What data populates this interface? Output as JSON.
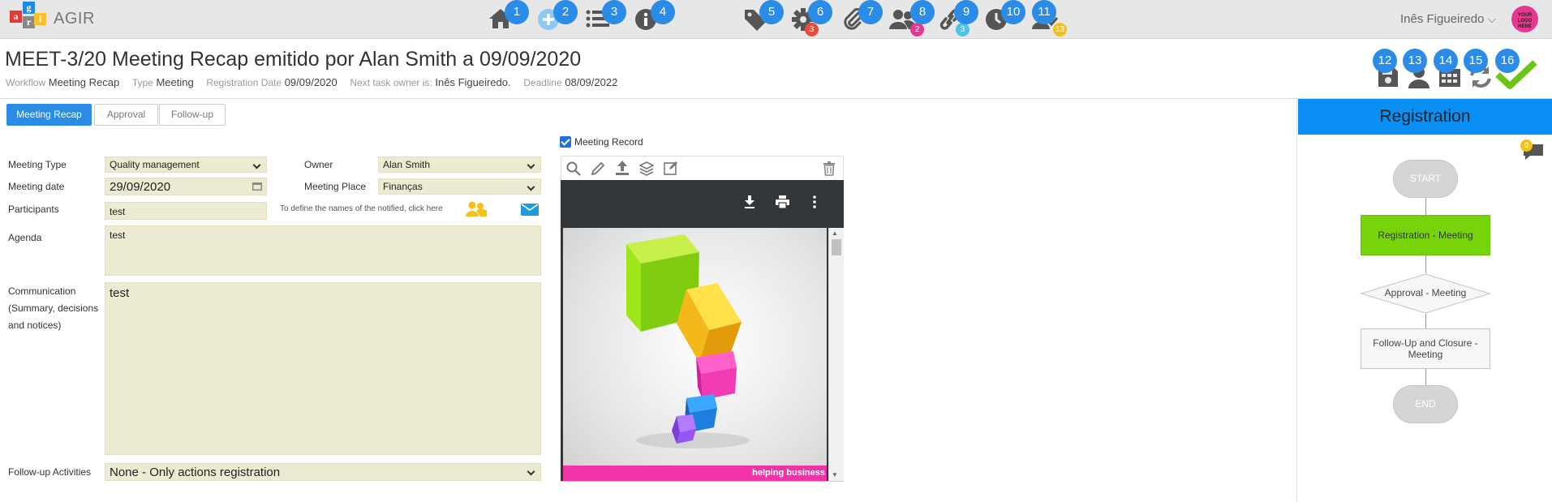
{
  "app": {
    "logo_letters": [
      "a",
      "g",
      "i",
      "r"
    ],
    "name": "AGIR",
    "user_name": "Inês Figueiredo",
    "avatar_text": "YOUR LOGO HERE"
  },
  "nav": [
    {
      "num": "1",
      "icon": "home-icon"
    },
    {
      "num": "2",
      "icon": "plus-circle-icon"
    },
    {
      "num": "3",
      "icon": "list-icon"
    },
    {
      "num": "4",
      "icon": "info-icon"
    },
    {
      "num": "5",
      "icon": "tag-icon"
    },
    {
      "num": "6",
      "icon": "gear-icon",
      "badge": "3"
    },
    {
      "num": "7",
      "icon": "paperclip-icon"
    },
    {
      "num": "8",
      "icon": "users-icon",
      "badge": "2"
    },
    {
      "num": "9",
      "icon": "link-icon",
      "badge": "3"
    },
    {
      "num": "10",
      "icon": "clock-icon"
    },
    {
      "num": "11",
      "icon": "user-check-icon",
      "badge": "13"
    }
  ],
  "page": {
    "title": "MEET-3/20 Meeting Recap emitido por Alan Smith a 09/09/2020",
    "meta": {
      "workflow_label": "Workflow",
      "workflow_value": "Meeting Recap",
      "type_label": "Type",
      "type_value": "Meeting",
      "regdate_label": "Registration Date",
      "regdate_value": "09/09/2020",
      "owner_label": "Next task owner is:",
      "owner_value": "Inês Figueiredo.",
      "deadline_label": "Deadline",
      "deadline_value": "08/09/2022"
    }
  },
  "actions": [
    {
      "num": "12",
      "icon": "save-icon"
    },
    {
      "num": "13",
      "icon": "user-icon"
    },
    {
      "num": "14",
      "icon": "calendar-icon"
    },
    {
      "num": "15",
      "icon": "refresh-icon"
    },
    {
      "num": "16",
      "icon": "check-icon"
    }
  ],
  "tabs": [
    "Meeting Recap",
    "Approval",
    "Follow-up"
  ],
  "form": {
    "meeting_type_label": "Meeting Type",
    "meeting_type_value": "Quality management",
    "owner_label": "Owner",
    "owner_value": "Alan Smith",
    "meeting_date_label": "Meeting date",
    "meeting_date_value": "29/09/2020",
    "meeting_place_label": "Meeting Place",
    "meeting_place_value": "Finanças",
    "participants_label": "Participants",
    "participants_value": "test",
    "notify_hint": "To define the names of the notified, click here",
    "agenda_label": "Agenda",
    "agenda_value": "test",
    "communication_label_1": "Communication",
    "communication_label_2": "(Summary, decisions",
    "communication_label_3": "and notices)",
    "communication_value": "test",
    "followup_label": "Follow-up Activities",
    "followup_value": "None - Only actions registration"
  },
  "record": {
    "checkbox_label": "Meeting Record",
    "checked": true,
    "banner_text": "helping business"
  },
  "workflow": {
    "title": "Registration",
    "start": "START",
    "step1": "Registration - Meeting",
    "step2": "Approval - Meeting",
    "step3": "Follow-Up and Closure - Meeting",
    "end": "END",
    "comments_count": "0",
    "active_color": "#78d40a"
  },
  "colors": {
    "accent": "#2a8ce6",
    "field_bg": "#ecebd2",
    "panel_header": "#0a8ff5",
    "badge_red": "#e84c3d",
    "badge_pink": "#e6388f",
    "badge_cyan": "#4cc3e8",
    "badge_yellow": "#f3c21a"
  }
}
